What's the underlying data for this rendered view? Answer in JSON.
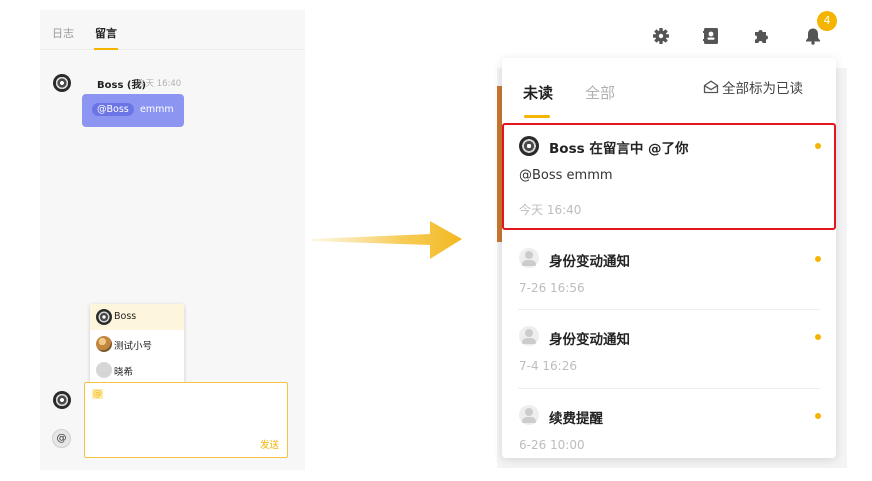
{
  "left": {
    "tabs": [
      "日志",
      "留言"
    ],
    "message": {
      "author": "Boss (我)",
      "time": "今天 16:40",
      "mention": "@Boss",
      "text": "emmm"
    },
    "mention_dropdown": {
      "items": [
        "Boss",
        "测试小号",
        "晓希"
      ]
    },
    "composer": {
      "value": "@",
      "send_label": "发送",
      "at_button": "@"
    }
  },
  "right": {
    "bell_badge": "4",
    "tabs": [
      "未读",
      "全部"
    ],
    "mark_all_read": "全部标为已读",
    "notifications": [
      {
        "title": "Boss 在留言中 @了你",
        "body": "@Boss emmm",
        "time": "今天 16:40",
        "unread": true
      },
      {
        "title": "身份变动通知",
        "time": "7-26 16:56",
        "unread": true
      },
      {
        "title": "身份变动通知",
        "time": "7-4 16:26",
        "unread": true
      },
      {
        "title": "续费提醒",
        "time": "6-26 10:00",
        "unread": true
      }
    ]
  },
  "colors": {
    "accent": "#f5b400",
    "bubble": "#8c95f2",
    "highlight": "#e4161d"
  }
}
